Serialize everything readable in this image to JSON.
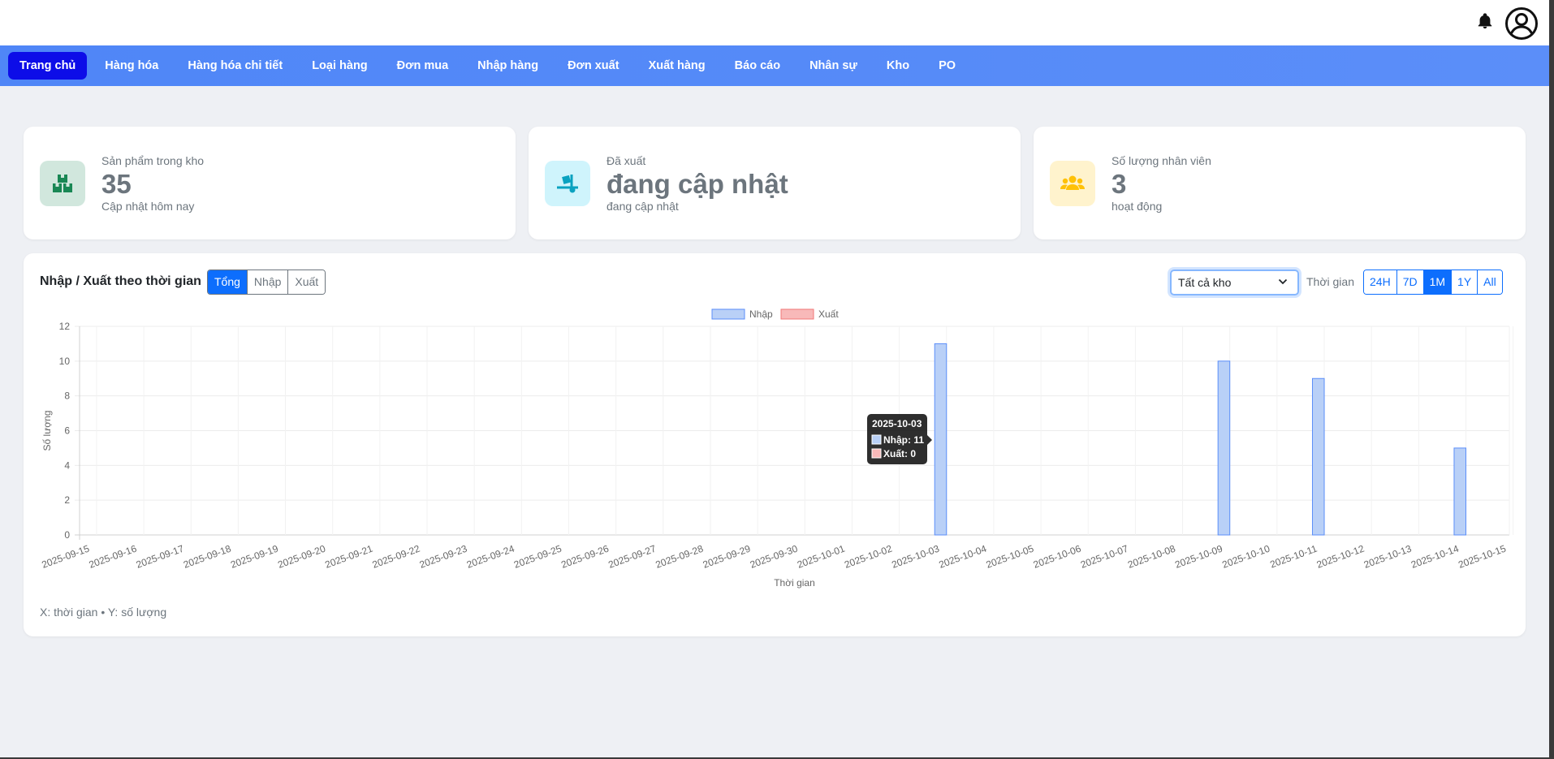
{
  "nav": {
    "items": [
      {
        "label": "Trang chủ",
        "active": true
      },
      {
        "label": "Hàng hóa"
      },
      {
        "label": "Hàng hóa chi tiết"
      },
      {
        "label": "Loại hàng"
      },
      {
        "label": "Đơn mua"
      },
      {
        "label": "Nhập hàng"
      },
      {
        "label": "Đơn xuất"
      },
      {
        "label": "Xuất hàng"
      },
      {
        "label": "Báo cáo"
      },
      {
        "label": "Nhân sự"
      },
      {
        "label": "Kho"
      },
      {
        "label": "PO"
      }
    ]
  },
  "stats": [
    {
      "label": "Sản phẩm trong kho",
      "value": "35",
      "sub": "Cập nhật hôm nay",
      "icon": "boxes-icon",
      "bg": "#d1e7dd",
      "fg": "#198754"
    },
    {
      "label": "Đã xuất",
      "value": "đang cập nhật",
      "sub": "đang cập nhật",
      "icon": "truck-loading-icon",
      "bg": "#cff4fc",
      "fg": "#0aa2c0"
    },
    {
      "label": "Số lượng nhân viên",
      "value": "3",
      "sub": "hoạt động",
      "icon": "users-icon",
      "bg": "#fff3cd",
      "fg": "#ffc107"
    }
  ],
  "panel": {
    "title": "Nhập / Xuất theo thời gian",
    "modes": [
      "Tổng",
      "Nhập",
      "Xuất"
    ],
    "active_mode": "Tổng",
    "warehouse_select": "Tất cả kho",
    "time_label": "Thời gian",
    "ranges": [
      "24H",
      "7D",
      "1M",
      "1Y",
      "All"
    ],
    "active_range": "1M",
    "footnote": "X: thời gian • Y: số lượng"
  },
  "chart_data": {
    "type": "bar",
    "categories": [
      "2025-09-15",
      "2025-09-16",
      "2025-09-17",
      "2025-09-18",
      "2025-09-19",
      "2025-09-20",
      "2025-09-21",
      "2025-09-22",
      "2025-09-23",
      "2025-09-24",
      "2025-09-25",
      "2025-09-26",
      "2025-09-27",
      "2025-09-28",
      "2025-09-29",
      "2025-09-30",
      "2025-10-01",
      "2025-10-02",
      "2025-10-03",
      "2025-10-04",
      "2025-10-05",
      "2025-10-06",
      "2025-10-07",
      "2025-10-08",
      "2025-10-09",
      "2025-10-10",
      "2025-10-11",
      "2025-10-12",
      "2025-10-13",
      "2025-10-14",
      "2025-10-15"
    ],
    "series": [
      {
        "name": "Nhập",
        "color": "#b9d0f7",
        "stroke": "#5b8ef9",
        "values": [
          0,
          0,
          0,
          0,
          0,
          0,
          0,
          0,
          0,
          0,
          0,
          0,
          0,
          0,
          0,
          0,
          0,
          0,
          11,
          0,
          0,
          0,
          0,
          0,
          10,
          0,
          9,
          0,
          0,
          5,
          0
        ]
      },
      {
        "name": "Xuất",
        "color": "#f8b9b9",
        "stroke": "#f17878",
        "values": [
          0,
          0,
          0,
          0,
          0,
          0,
          0,
          0,
          0,
          0,
          0,
          0,
          0,
          0,
          0,
          0,
          0,
          0,
          0,
          0,
          0,
          0,
          0,
          0,
          0,
          0,
          0,
          0,
          0,
          0,
          0
        ]
      }
    ],
    "xlabel": "Thời gian",
    "ylabel": "Số lượng",
    "ylim": [
      0,
      12
    ],
    "yticks": [
      0,
      2,
      4,
      6,
      8,
      10,
      12
    ],
    "grid": true,
    "legend": "top-center",
    "tooltip": {
      "title": "2025-10-03",
      "lines": [
        "Nhập: 11",
        "Xuất: 0"
      ],
      "category_index": 18
    }
  }
}
